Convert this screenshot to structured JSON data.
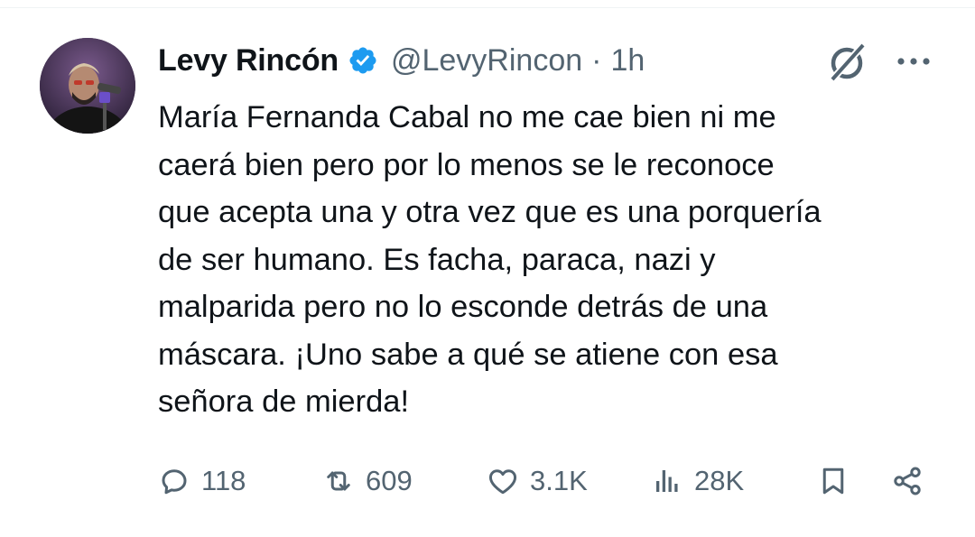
{
  "tweet": {
    "author": {
      "display_name": "Levy Rincón",
      "handle": "@LevyRincon",
      "verified_icon": "verified-badge-icon"
    },
    "separator": "·",
    "timestamp": "1h",
    "text": "María Fernanda Cabal no me cae bien ni me\ncaerá bien pero por lo menos se le reconoce\nque acepta una y otra vez que es una porquería\nde ser humano. Es facha, paraca, nazi y\nmalparida pero no lo esconde detrás de una\nmáscara. ¡Uno sabe a qué se atiene con esa\nseñora de mierda!",
    "actions": {
      "replies": "118",
      "reposts": "609",
      "likes": "3.1K",
      "views": "28K"
    }
  },
  "colors": {
    "text": "#0f1419",
    "secondary": "#536471",
    "verified_blue": "#1d9bf0"
  }
}
